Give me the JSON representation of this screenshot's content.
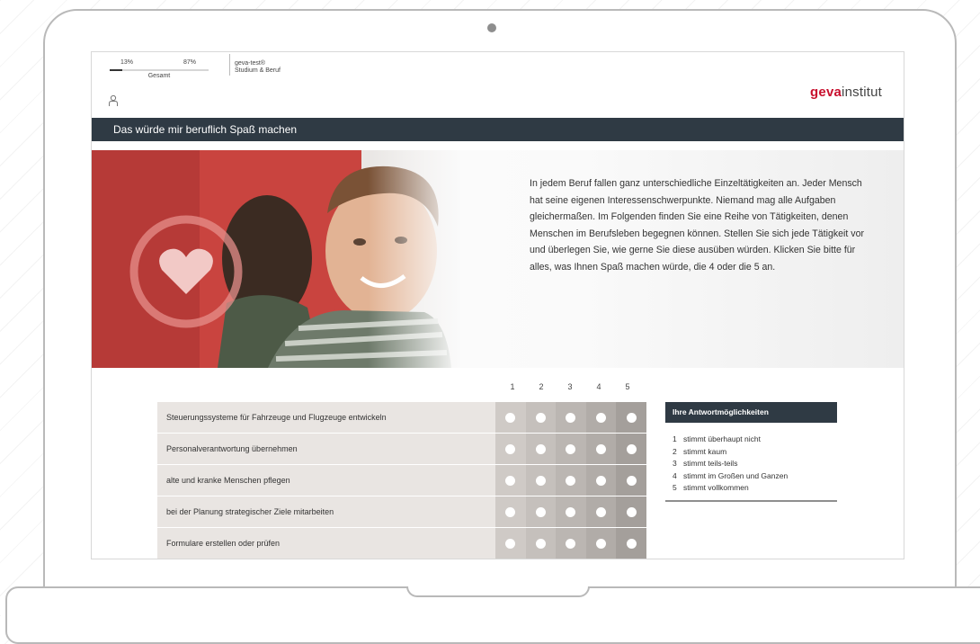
{
  "progress": {
    "left_value": "13%",
    "right_value": "87%",
    "label": "Gesamt",
    "fraction": 0.13
  },
  "product": {
    "line1": "geva-test®",
    "line2": "Studium & Beruf"
  },
  "brand": {
    "strong": "geva",
    "light": "institut",
    "color": "#c8102e"
  },
  "page_title": "Das würde mir beruflich Spaß machen",
  "intro_text": "In jedem Beruf fallen ganz unterschiedliche Einzeltätigkeiten an. Jeder Mensch hat seine eigenen Interessenschwerpunkte. Niemand mag alle Aufgaben gleichermaßen. Im Folgenden finden Sie eine Reihe von Tätigkeiten, denen Menschen im Berufsleben begegnen können. Stellen Sie sich jede Tätigkeit vor und überlegen Sie, wie gerne Sie diese ausüben würden. Klicken Sie bitte für alles, was Ihnen Spaß machen würde, die 4 oder die 5 an.",
  "scale": [
    "1",
    "2",
    "3",
    "4",
    "5"
  ],
  "items": [
    {
      "label": "Steuerungssysteme für Fahrzeuge und Flugzeuge entwickeln"
    },
    {
      "label": "Personalverantwortung übernehmen"
    },
    {
      "label": "alte und kranke Menschen pflegen"
    },
    {
      "label": "bei der Planung strategischer Ziele mitarbeiten"
    },
    {
      "label": "Formulare erstellen oder prüfen"
    }
  ],
  "legend": {
    "title": "Ihre Antwortmöglichkeiten",
    "options": [
      {
        "n": "1",
        "text": "stimmt überhaupt nicht"
      },
      {
        "n": "2",
        "text": "stimmt kaum"
      },
      {
        "n": "3",
        "text": "stimmt teils-teils"
      },
      {
        "n": "4",
        "text": "stimmt im Großen und Ganzen"
      },
      {
        "n": "5",
        "text": "stimmt vollkommen"
      }
    ]
  },
  "colors": {
    "title_bar": "#2f3a44",
    "accent_red": "#c8102e"
  },
  "icons": [
    "user-icon",
    "heart-icon",
    "camera-icon"
  ]
}
